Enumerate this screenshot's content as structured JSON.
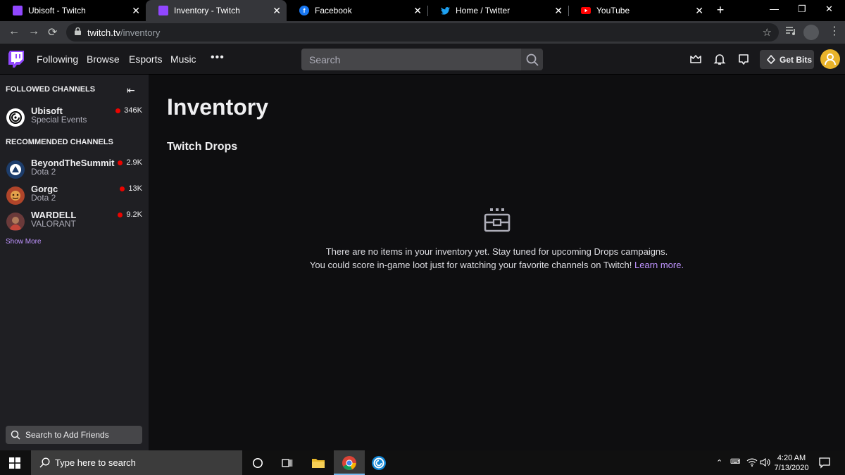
{
  "browser": {
    "tabs": [
      {
        "title": "Ubisoft - Twitch",
        "icon": "twitch-icon"
      },
      {
        "title": "Inventory - Twitch",
        "icon": "twitch-icon"
      },
      {
        "title": "Facebook",
        "icon": "facebook-icon"
      },
      {
        "title": "Home / Twitter",
        "icon": "twitter-icon"
      },
      {
        "title": "YouTube",
        "icon": "youtube-icon"
      }
    ],
    "active_tab": 1,
    "url_host": "twitch.tv",
    "url_path": "/inventory"
  },
  "topnav": {
    "links": [
      "Following",
      "Browse",
      "Esports",
      "Music"
    ],
    "more": "•••",
    "search_placeholder": "Search",
    "get_bits": "Get Bits"
  },
  "sidebar": {
    "followed_heading": "FOLLOWED CHANNELS",
    "followed": [
      {
        "name": "Ubisoft",
        "game": "Special Events",
        "viewers": "346K",
        "avatar_color": "#ffffff"
      }
    ],
    "recommended_heading": "RECOMMENDED CHANNELS",
    "recommended": [
      {
        "name": "BeyondTheSummit",
        "game": "Dota 2",
        "viewers": "2.9K",
        "avatar_color": "#1d3d6b"
      },
      {
        "name": "Gorgc",
        "game": "Dota 2",
        "viewers": "13K",
        "avatar_color": "#b0452a"
      },
      {
        "name": "WARDELL",
        "game": "VALORANT",
        "viewers": "9.2K",
        "avatar_color": "#6a3a3a"
      }
    ],
    "show_more": "Show More",
    "friends_placeholder": "Search to Add Friends"
  },
  "main": {
    "title": "Inventory",
    "section": "Twitch Drops",
    "empty_line1": "There are no items in your inventory yet. Stay tuned for upcoming Drops campaigns.",
    "empty_line2": "You could score in-game loot just for watching your favorite channels on Twitch!",
    "learn_more": "Learn more."
  },
  "taskbar": {
    "search_placeholder": "Type here to search",
    "time": "4:20 AM",
    "date": "7/13/2020"
  },
  "colors": {
    "accent": "#9147ff",
    "link": "#bf94ff",
    "live": "#eb0400"
  }
}
